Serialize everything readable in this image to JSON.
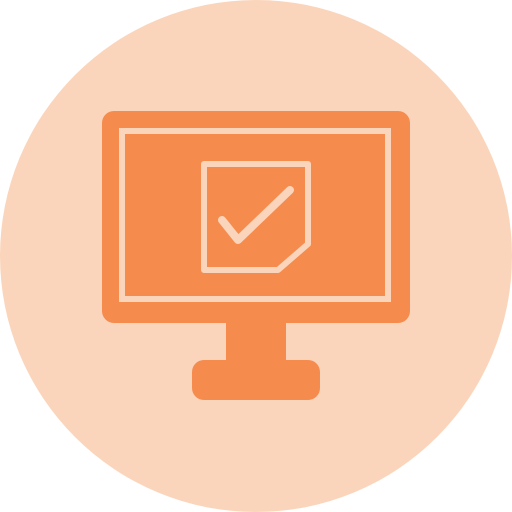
{
  "icon": {
    "name": "monitor-checklist-icon",
    "colors": {
      "background_circle": "#FBD5BB",
      "device": "#F68B4E",
      "line_art": "#FBD5BB"
    }
  }
}
